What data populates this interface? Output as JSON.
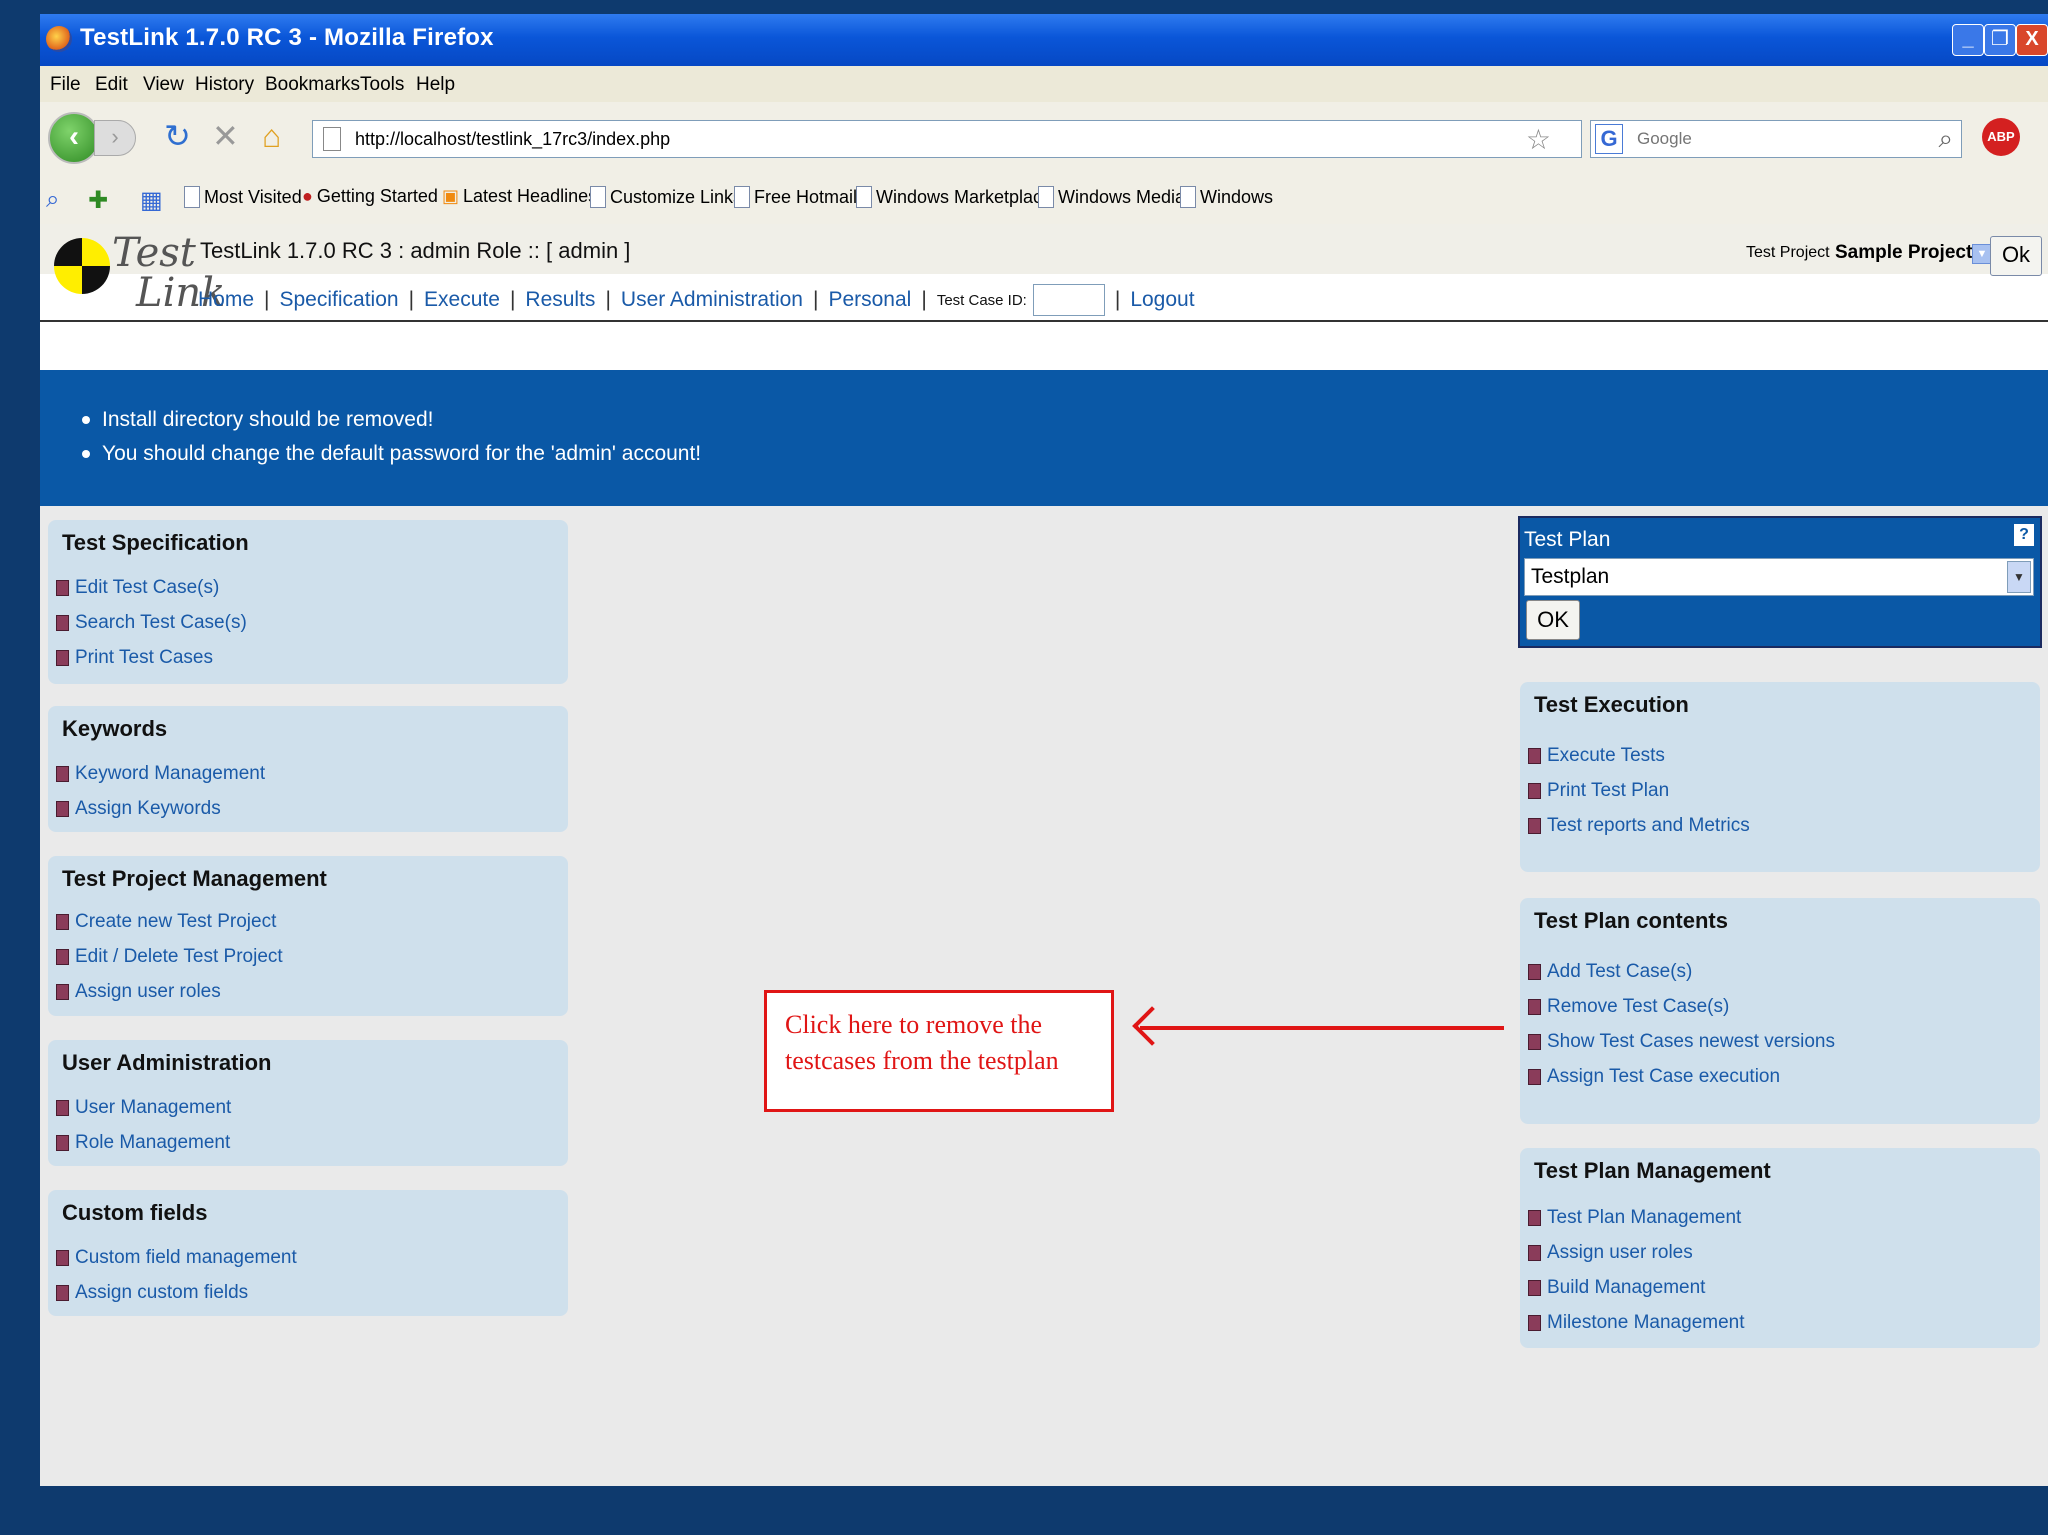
{
  "window": {
    "title": "TestLink 1.7.0 RC 3 - Mozilla Firefox"
  },
  "menubar": [
    "File",
    "Edit",
    "View",
    "History",
    "Bookmarks",
    "Tools",
    "Help"
  ],
  "address": {
    "url": "http://localhost/testlink_17rc3/index.php"
  },
  "search": {
    "placeholder": "Google"
  },
  "abp_label": "ABP",
  "bookmarks": [
    "Most Visited",
    "Getting Started",
    "Latest Headlines",
    "Customize Links",
    "Free Hotmail",
    "Windows Marketplace",
    "Windows Media",
    "Windows"
  ],
  "testlink": {
    "logo_top": "Test",
    "logo_bottom": "Link",
    "title": "TestLink 1.7.0 RC 3 : admin Role :: [ admin ]",
    "project_label": "Test Project",
    "project_name": "Sample Project",
    "ok_label": "Ok",
    "nav": [
      "Home",
      "Specification",
      "Execute",
      "Results",
      "User Administration",
      "Personal"
    ],
    "testcase_id_label": "Test Case ID:",
    "logout": "Logout"
  },
  "warnings": [
    "Install directory should be removed!",
    "You should change the default password for the 'admin' account!"
  ],
  "left_panels": [
    {
      "title": "Test Specification",
      "items": [
        "Edit Test Case(s)",
        "Search Test Case(s)",
        "Print Test Cases"
      ]
    },
    {
      "title": "Keywords",
      "items": [
        "Keyword Management",
        "Assign Keywords"
      ]
    },
    {
      "title": "Test Project Management",
      "items": [
        "Create new Test Project",
        "Edit / Delete Test Project",
        "Assign user roles"
      ]
    },
    {
      "title": "User Administration",
      "items": [
        "User Management",
        "Role Management"
      ]
    },
    {
      "title": "Custom fields",
      "items": [
        "Custom field management",
        "Assign custom fields"
      ]
    }
  ],
  "test_plan": {
    "label": "Test Plan",
    "help": "?",
    "selected": "Testplan",
    "ok": "OK"
  },
  "right_panels": [
    {
      "title": "Test Execution",
      "items": [
        "Execute Tests",
        "Print Test Plan",
        "Test reports and Metrics"
      ]
    },
    {
      "title": "Test Plan contents",
      "items": [
        "Add Test Case(s)",
        "Remove Test Case(s)",
        "Show Test Cases newest versions",
        "Assign Test Case execution"
      ]
    },
    {
      "title": "Test Plan Management",
      "items": [
        "Test Plan Management",
        "Assign user roles",
        "Build Management",
        "Milestone Management"
      ]
    }
  ],
  "callout": {
    "line1": "Click here to remove the",
    "line2": "testcases from the testplan"
  },
  "colors": {
    "banner": "#0a58a6",
    "link": "#1a5aa8",
    "callout": "#e01515",
    "panel": "#cfe0ec"
  }
}
